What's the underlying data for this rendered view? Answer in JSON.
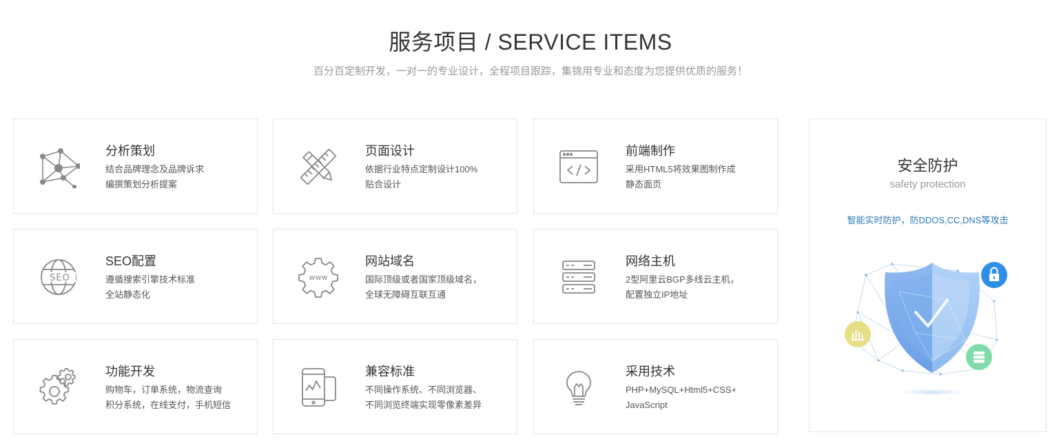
{
  "header": {
    "title": "服务项目 / SERVICE ITEMS",
    "subtitle": "百分百定制开发，一对一的专业设计，全程项目跟踪，集锦用专业和态度为您提供优质的服务！"
  },
  "services": [
    {
      "icon": "network-nodes-icon",
      "title": "分析策划",
      "lines": [
        "结合品牌理念及品牌诉求",
        "编撰策划分析提案"
      ]
    },
    {
      "icon": "pencil-ruler-icon",
      "title": "页面设计",
      "lines": [
        "依据行业特点定制设计100%",
        "贴合设计"
      ]
    },
    {
      "icon": "code-window-icon",
      "title": "前端制作",
      "lines": [
        "采用HTML5将效果图制作成",
        "静态面页"
      ]
    },
    {
      "icon": "seo-globe-icon",
      "title": "SEO配置",
      "lines": [
        "遵循搜索引擎技术标准",
        "全站静态化"
      ]
    },
    {
      "icon": "www-gear-icon",
      "title": "网站域名",
      "lines": [
        "国际顶级或者国家顶级域名，",
        "全球无障碍互联互通"
      ]
    },
    {
      "icon": "server-rack-icon",
      "title": "网络主机",
      "lines": [
        "2型阿里云BGP多线云主机，",
        "配置独立IP地址"
      ]
    },
    {
      "icon": "gears-icon",
      "title": "功能开发",
      "lines": [
        "购物车，订单系统，物流查询",
        "积分系统，在线支付，手机短信"
      ]
    },
    {
      "icon": "devices-icon",
      "title": "兼容标准",
      "lines": [
        "不同操作系统、不同浏览器、",
        "不同浏览终端实现零像素差异"
      ]
    },
    {
      "icon": "lightbulb-icon",
      "title": "采用技术",
      "lines": [
        "PHP+MySQL+Html5+CSS+",
        "JavaScript"
      ]
    }
  ],
  "security": {
    "title": "安全防护",
    "subtitle": "safety protection",
    "description": "智能实时防护，防DDOS,CC,DNS等攻击",
    "accent_color": "#2a7ab8",
    "icons": [
      "shield-check-icon",
      "lock-icon",
      "chart-icon",
      "server-icon"
    ]
  }
}
